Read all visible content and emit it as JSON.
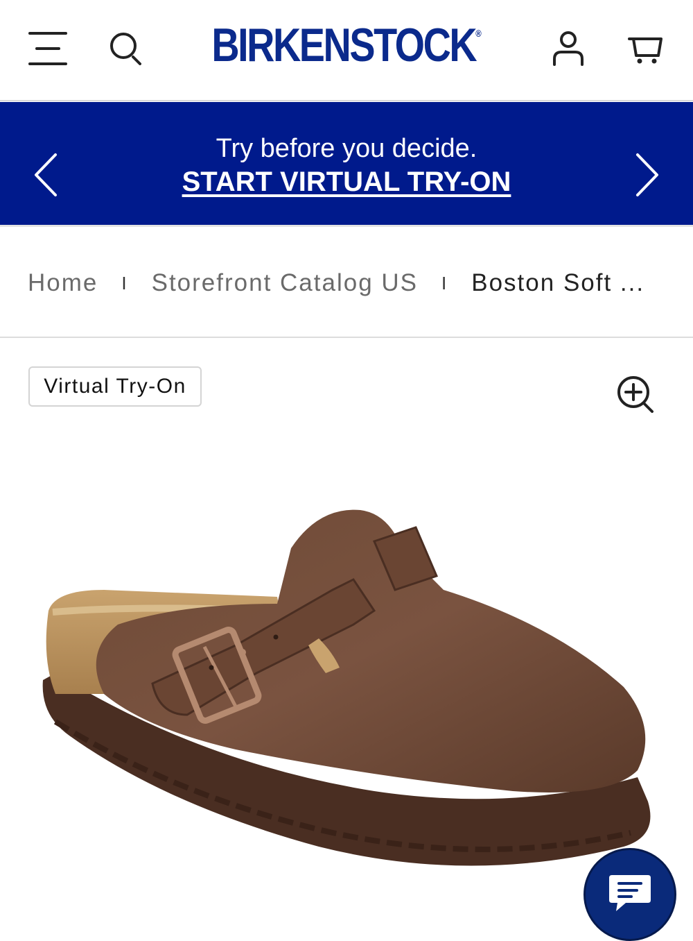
{
  "header": {
    "logo": "BIRKENSTOCK",
    "logo_mark": "®",
    "icons": [
      "hamburger-menu-icon",
      "search-icon",
      "account-icon",
      "cart-icon"
    ]
  },
  "promo": {
    "text": "Try before you decide.",
    "cta": "START VIRTUAL TRY-ON",
    "background_color": "#001a8c"
  },
  "breadcrumb": {
    "items": [
      "Home",
      "Storefront Catalog US"
    ],
    "current": "Boston Soft ...",
    "separator": "I"
  },
  "product": {
    "tryon_label": "Virtual Try-On",
    "image_description": "brown leather clog with buckle strap"
  },
  "colors": {
    "brand": "#0b2a8c",
    "chat": "#0a2a7a"
  }
}
